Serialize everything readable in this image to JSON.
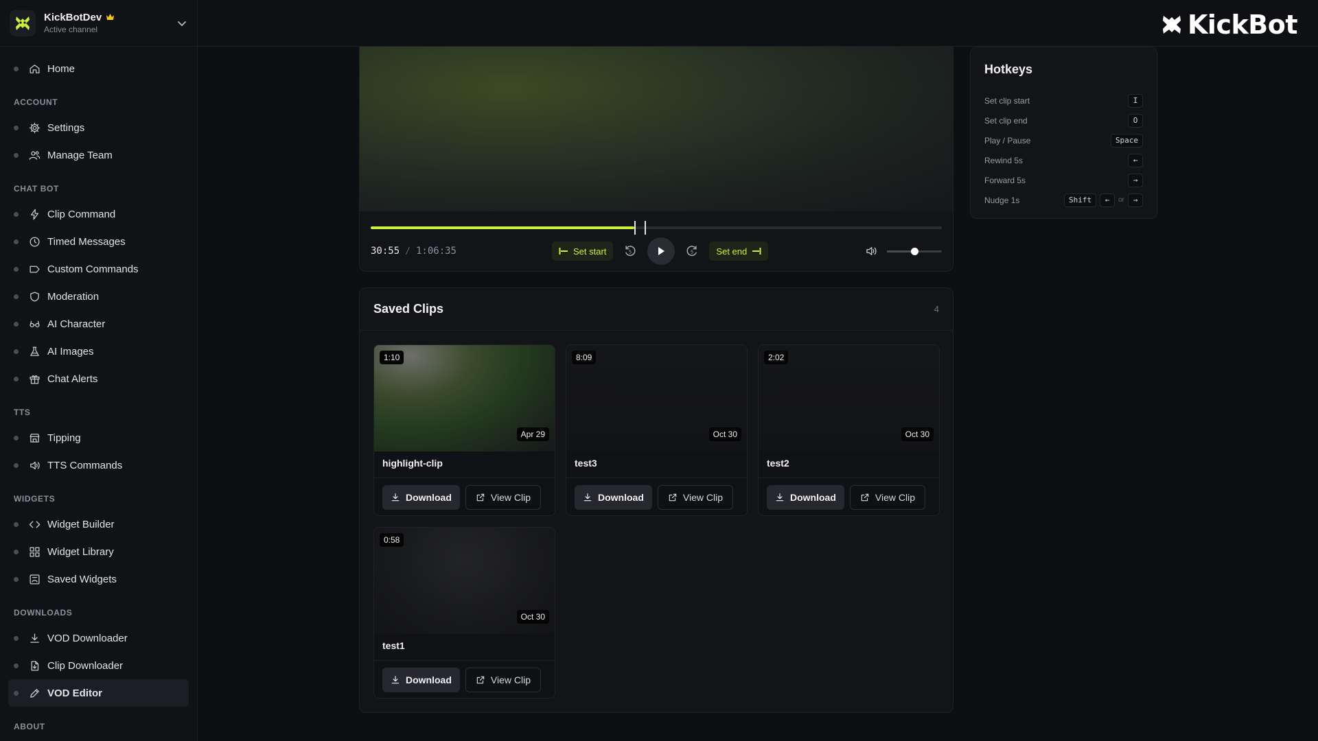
{
  "channel": {
    "name": "KickBotDev",
    "status": "Active channel"
  },
  "brand": {
    "name": "KickBot",
    "accent": "#c8f23a"
  },
  "nav": {
    "home": "Home",
    "sections": {
      "account": "ACCOUNT",
      "chatbot": "CHAT BOT",
      "tts": "TTS",
      "widgets": "WIDGETS",
      "downloads": "DOWNLOADS",
      "about": "ABOUT"
    },
    "items": {
      "settings": "Settings",
      "manage_team": "Manage Team",
      "clip_command": "Clip Command",
      "timed_messages": "Timed Messages",
      "custom_commands": "Custom Commands",
      "moderation": "Moderation",
      "ai_character": "AI Character",
      "ai_images": "AI Images",
      "chat_alerts": "Chat Alerts",
      "tipping": "Tipping",
      "tts_commands": "TTS Commands",
      "widget_builder": "Widget Builder",
      "widget_library": "Widget Library",
      "saved_widgets": "Saved Widgets",
      "vod_downloader": "VOD Downloader",
      "clip_downloader": "Clip Downloader",
      "vod_editor": "VOD Editor"
    },
    "active": "vod_editor"
  },
  "player": {
    "current_time": "30:55",
    "separator": "/",
    "total_time": "1:06:35",
    "progress_fraction": 0.46,
    "marker_fractions": [
      0.46,
      0.478
    ],
    "set_start_label": "Set start",
    "set_end_label": "Set end",
    "volume_fraction": 0.5
  },
  "hotkeys": {
    "title": "Hotkeys",
    "rows": [
      {
        "label": "Set clip start",
        "keys": [
          "I"
        ]
      },
      {
        "label": "Set clip end",
        "keys": [
          "O"
        ]
      },
      {
        "label": "Play / Pause",
        "keys": [
          "Space"
        ]
      },
      {
        "label": "Rewind 5s",
        "keys": [
          "←"
        ]
      },
      {
        "label": "Forward 5s",
        "keys": [
          "→"
        ]
      },
      {
        "label": "Nudge 1s",
        "keys": [
          "Shift",
          "←",
          "→"
        ],
        "or": "or"
      }
    ]
  },
  "clips": {
    "title": "Saved Clips",
    "count": "4",
    "download_label": "Download",
    "view_label": "View Clip",
    "items": [
      {
        "name": "highlight-clip",
        "duration": "1:10",
        "date": "Apr 29"
      },
      {
        "name": "test3",
        "duration": "8:09",
        "date": "Oct 30"
      },
      {
        "name": "test2",
        "duration": "2:02",
        "date": "Oct 30"
      },
      {
        "name": "test1",
        "duration": "0:58",
        "date": "Oct 30"
      }
    ]
  }
}
